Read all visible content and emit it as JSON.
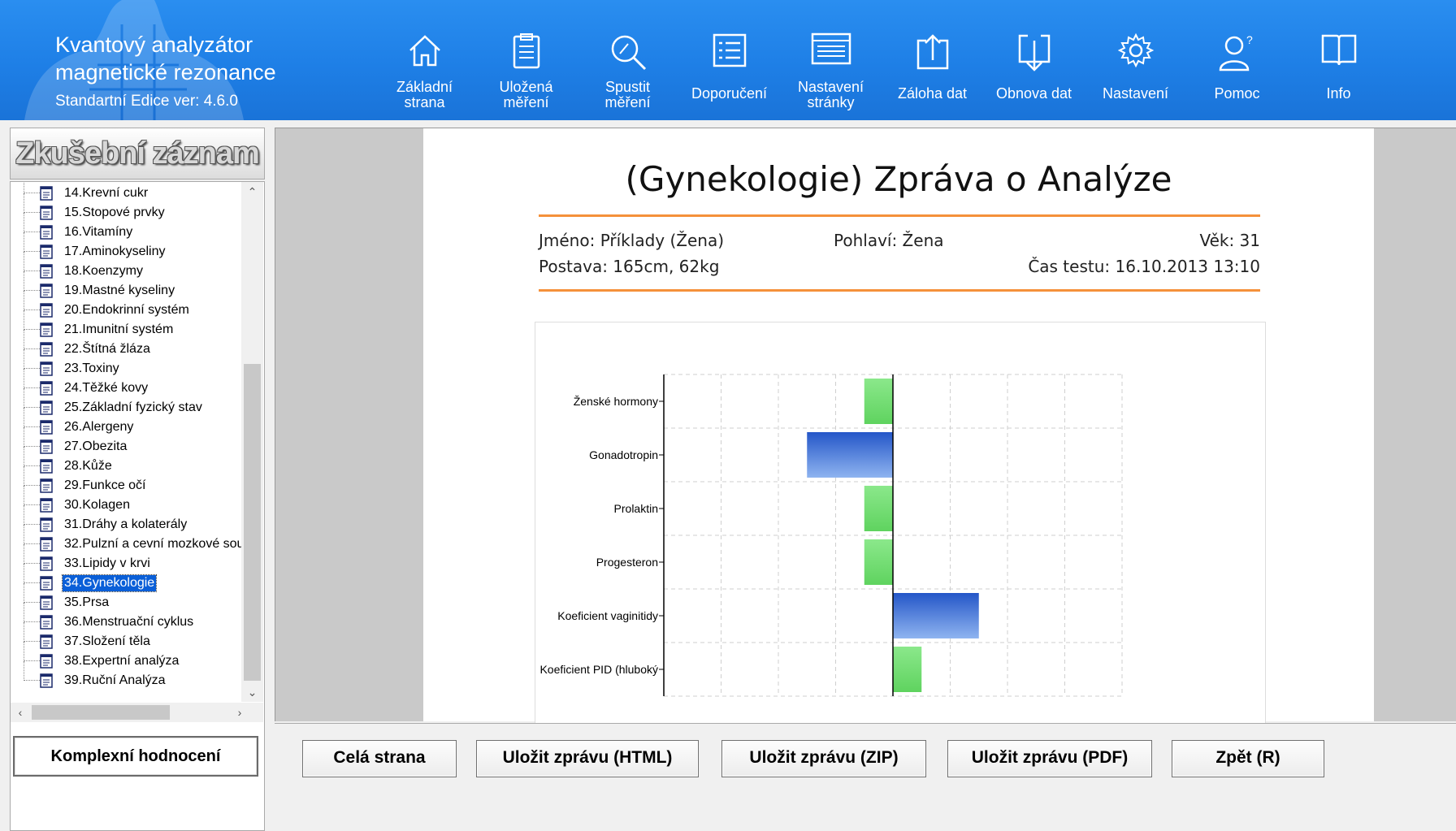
{
  "brand": {
    "line1": "Kvantový analyzátor",
    "line2": "magnetické rezonance",
    "version": "Standartní Edice ver: 4.6.0"
  },
  "toolbar": [
    {
      "icon": "home-icon",
      "line1": "Základní",
      "line2": "strana"
    },
    {
      "icon": "clipboard-icon",
      "line1": "Uložená",
      "line2": "měření"
    },
    {
      "icon": "magnifier-icon",
      "line1": "Spustit",
      "line2": "měření"
    },
    {
      "icon": "list-icon",
      "line1": "Doporučení",
      "line2": ""
    },
    {
      "icon": "page-settings-icon",
      "line1": "Nastavení",
      "line2": "stránky"
    },
    {
      "icon": "upload-icon",
      "line1": "Záloha dat",
      "line2": ""
    },
    {
      "icon": "download-icon",
      "line1": "Obnova dat",
      "line2": ""
    },
    {
      "icon": "gear-icon",
      "line1": "Nastavení",
      "line2": ""
    },
    {
      "icon": "help-user-icon",
      "line1": "Pomoc",
      "line2": ""
    },
    {
      "icon": "book-icon",
      "line1": "Info",
      "line2": ""
    }
  ],
  "left_panel": {
    "title": "Zkušební záznam",
    "items": [
      "14.Krevní cukr",
      "15.Stopové prvky",
      "16.Vitamíny",
      "17.Aminokyseliny",
      "18.Koenzymy",
      "19.Mastné kyseliny",
      "20.Endokrinní systém",
      "21.Imunitní systém",
      "22.Štítná žláza",
      "23.Toxiny",
      "24.Těžké kovy",
      "25.Základní fyzický stav",
      "26.Alergeny",
      "27.Obezita",
      "28.Kůže",
      "29.Funkce očí",
      "30.Kolagen",
      "31.Dráhy a kolaterály",
      "32.Pulzní a cevní mozkové sou",
      "33.Lipidy v krvi",
      "34.Gynekologie",
      "35.Prsa",
      "36.Menstruační cyklus",
      "37.Složení těla",
      "38.Expertní analýza",
      "39.Ruční Analýza"
    ],
    "selected": "34.Gynekologie",
    "complex_button": "Komplexní hodnocení"
  },
  "report": {
    "title": "(Gynekologie) Zpráva o Analýze",
    "name": "Jméno: Příklady (Žena)",
    "gender": "Pohlaví: Žena",
    "age": "Věk: 31",
    "body": "Postava: 165cm, 62kg",
    "test_time": "Čas testu: 16.10.2013 13:10"
  },
  "chart_data": {
    "type": "bar",
    "orientation": "horizontal",
    "categories": [
      "Ženské hormony",
      "Gonadotropin",
      "Prolaktin",
      "Progesteron",
      "Koeficient vaginitidy",
      "Koeficient PID (hluboký"
    ],
    "values": [
      -0.5,
      -1.5,
      -0.5,
      -0.5,
      1.5,
      0.5
    ],
    "colors": [
      "#66dd66",
      "#3a6fd8",
      "#66dd66",
      "#66dd66",
      "#3a6fd8",
      "#66dd66"
    ],
    "xlim": [
      -4,
      4
    ],
    "grid": true
  },
  "buttons": {
    "full_page": "Celá strana",
    "save_html": "Uložit zprávu (HTML)",
    "save_zip": "Uložit zprávu (ZIP)",
    "save_pdf": "Uložit zprávu (PDF)",
    "back": "Zpět (R)"
  }
}
